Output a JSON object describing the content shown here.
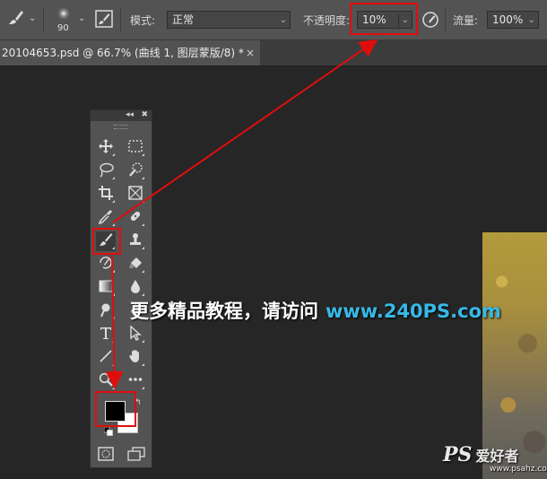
{
  "options_bar": {
    "brush_size": "90",
    "mode_label": "模式:",
    "mode_value": "正常",
    "opacity_label": "不透明度:",
    "opacity_value": "10%",
    "flow_label": "流量:",
    "flow_value": "100%"
  },
  "document": {
    "tab_title": "20104653.psd @ 66.7% (曲线 1, 图层蒙版/8) *",
    "close_glyph": "×"
  },
  "toolbox": {
    "header_collapse": "◂◂",
    "header_close": "✖"
  },
  "watermark": {
    "text": "更多精品教程，请访问",
    "url": "www.240PS.com"
  },
  "logo": {
    "brand": "PS",
    "cn": "爱好者",
    "site": "www.psahz.com"
  },
  "colors": {
    "highlight": "#e10d0d",
    "watermark_url": "#37b9e6",
    "foreground": "#000000",
    "background": "#ffffff"
  }
}
